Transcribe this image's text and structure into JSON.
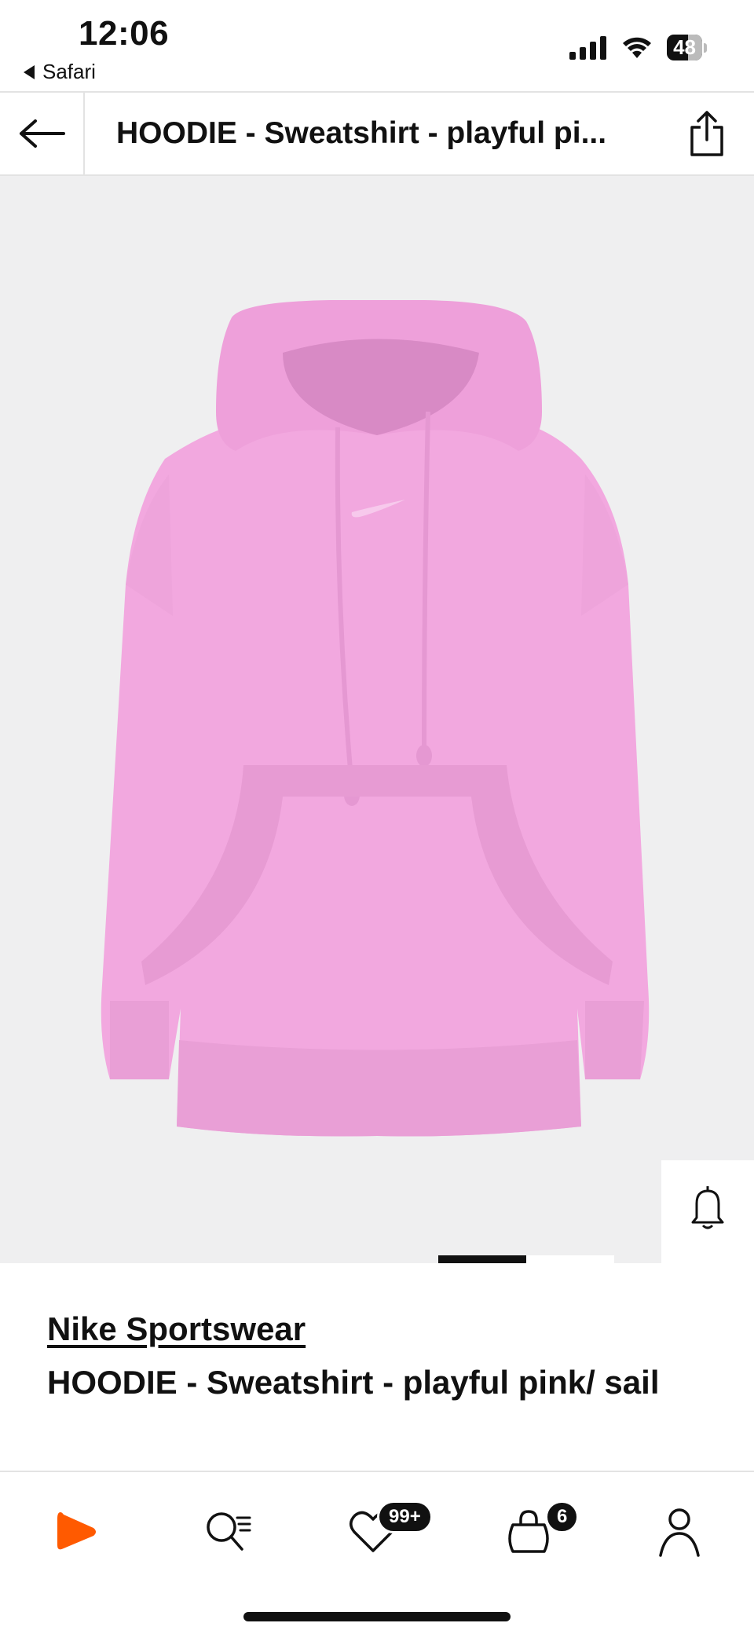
{
  "status_bar": {
    "time": "12:06",
    "back_app": "Safari",
    "battery": "48",
    "icons": [
      "signal-icon",
      "wifi-icon",
      "battery-icon"
    ]
  },
  "nav": {
    "title": "HOODIE - Sweatshirt - playful pi...",
    "icons": [
      "back-arrow-icon",
      "share-icon"
    ]
  },
  "product": {
    "brand": "Nike Sportswear",
    "name": "HOODIE - Sweatshirt - playful pink/ sail",
    "image_color": "#f2a8df",
    "image_background": "#efeff0",
    "actions": [
      "bell-icon",
      "heart-icon",
      "bag-icon"
    ],
    "similar_icon": "sparkle-frame-icon",
    "gallery_position": 1
  },
  "tabbar": {
    "tabs": [
      "home-icon",
      "search-icon",
      "wishlist-icon",
      "bag-icon",
      "profile-icon"
    ],
    "wishlist_badge": "99+",
    "bag_badge": "6",
    "accent": "#ff5a00"
  }
}
